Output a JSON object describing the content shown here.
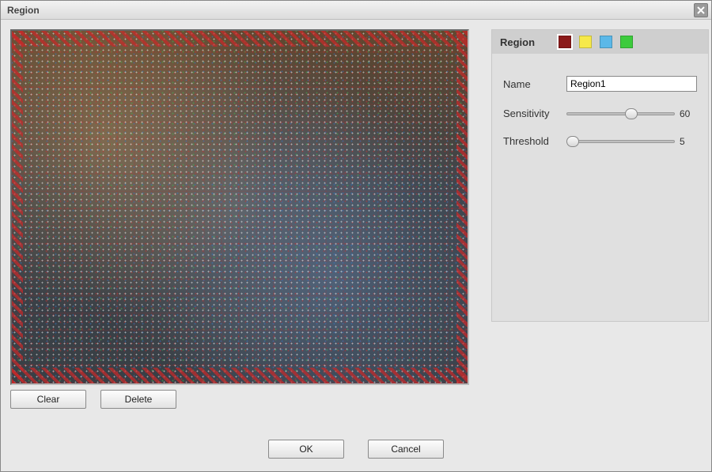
{
  "dialog": {
    "title": "Region"
  },
  "preview": {
    "clear_label": "Clear",
    "delete_label": "Delete"
  },
  "region_panel": {
    "header_label": "Region",
    "colors": [
      {
        "name": "red",
        "hex": "#8B1A1A",
        "selected": true
      },
      {
        "name": "yellow",
        "hex": "#F6E94A",
        "selected": false
      },
      {
        "name": "blue",
        "hex": "#5BB8E8",
        "selected": false
      },
      {
        "name": "green",
        "hex": "#3CCB3C",
        "selected": false
      }
    ],
    "name": {
      "label": "Name",
      "value": "Region1"
    },
    "sensitivity": {
      "label": "Sensitivity",
      "value": 60,
      "min": 0,
      "max": 100
    },
    "threshold": {
      "label": "Threshold",
      "value": 5,
      "min": 0,
      "max": 100
    }
  },
  "footer": {
    "ok_label": "OK",
    "cancel_label": "Cancel"
  }
}
